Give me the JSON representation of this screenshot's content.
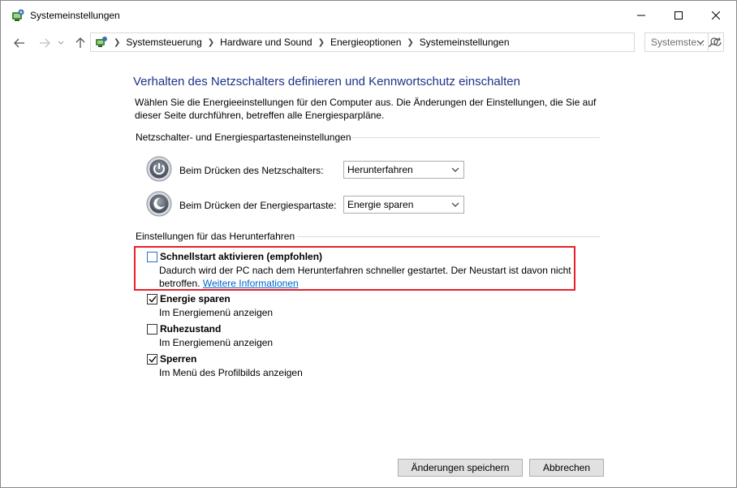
{
  "window": {
    "title": "Systemeinstellungen"
  },
  "address_bar": {
    "breadcrumbs": [
      "Systemsteuerung",
      "Hardware und Sound",
      "Energieoptionen",
      "Systemeinstellungen"
    ],
    "search_placeholder": "Systemste..."
  },
  "page": {
    "title": "Verhalten des Netzschalters definieren und Kennwortschutz einschalten",
    "description": "Wählen Sie die Energieeinstellungen für den Computer aus. Die Änderungen der Einstellungen, die Sie auf dieser Seite durchführen, betreffen alle Energiesparpläne."
  },
  "power_buttons": {
    "header": "Netzschalter- und Energiespartasteneinstellungen",
    "rows": [
      {
        "label": "Beim Drücken des Netzschalters:",
        "value": "Herunterfahren",
        "icon": "power-icon"
      },
      {
        "label": "Beim Drücken der Energiespartaste:",
        "value": "Energie sparen",
        "icon": "sleep-icon"
      }
    ]
  },
  "shutdown": {
    "header": "Einstellungen für das Herunterfahren",
    "fast_startup": {
      "title": "Schnellstart aktivieren (empfohlen)",
      "description": "Dadurch wird der PC nach dem Herunterfahren schneller gestartet. Der Neustart ist davon nicht betroffen.",
      "link": "Weitere Informationen",
      "checked": false
    },
    "options": [
      {
        "title": "Energie sparen",
        "subtitle": "Im Energiemenü anzeigen",
        "checked": true
      },
      {
        "title": "Ruhezustand",
        "subtitle": "Im Energiemenü anzeigen",
        "checked": false
      },
      {
        "title": "Sperren",
        "subtitle": "Im Menü des Profilbilds anzeigen",
        "checked": true
      }
    ]
  },
  "footer": {
    "save_label": "Änderungen speichern",
    "cancel_label": "Abbrechen"
  },
  "colors": {
    "title_blue": "#1e3287",
    "highlight_red": "#e8202a",
    "link_blue": "#0066cc"
  }
}
